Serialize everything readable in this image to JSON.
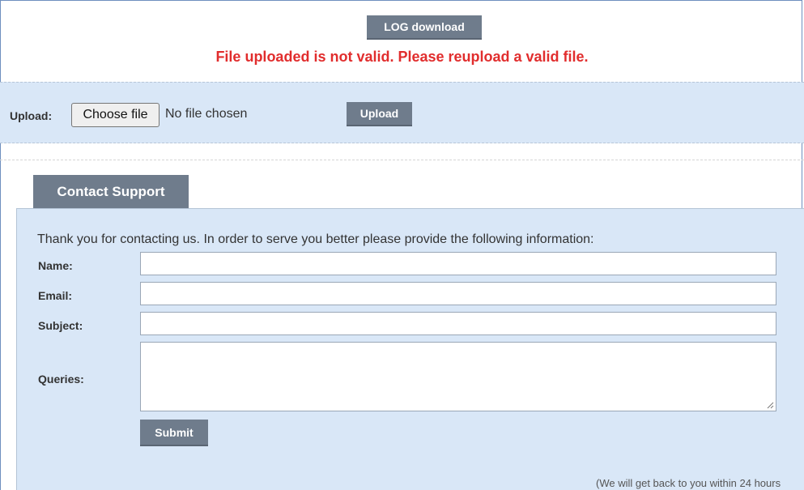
{
  "header": {
    "log_download_label": "LOG download",
    "error_message": "File uploaded is not valid. Please reupload a valid file."
  },
  "upload": {
    "label": "Upload:",
    "choose_file_label": "Choose file",
    "no_file_text": "No file chosen",
    "upload_button_label": "Upload"
  },
  "contact": {
    "tab_label": "Contact Support",
    "intro": "Thank you for contacting us. In order to serve you better please provide the following information:",
    "fields": {
      "name_label": "Name:",
      "email_label": "Email:",
      "subject_label": "Subject:",
      "queries_label": "Queries:"
    },
    "submit_label": "Submit",
    "footer_note": "(We will get back to you within 24 hours"
  },
  "colors": {
    "button_bg": "#6f7c8c",
    "panel_bg": "#d9e7f7",
    "error_text": "#e12d2d"
  }
}
